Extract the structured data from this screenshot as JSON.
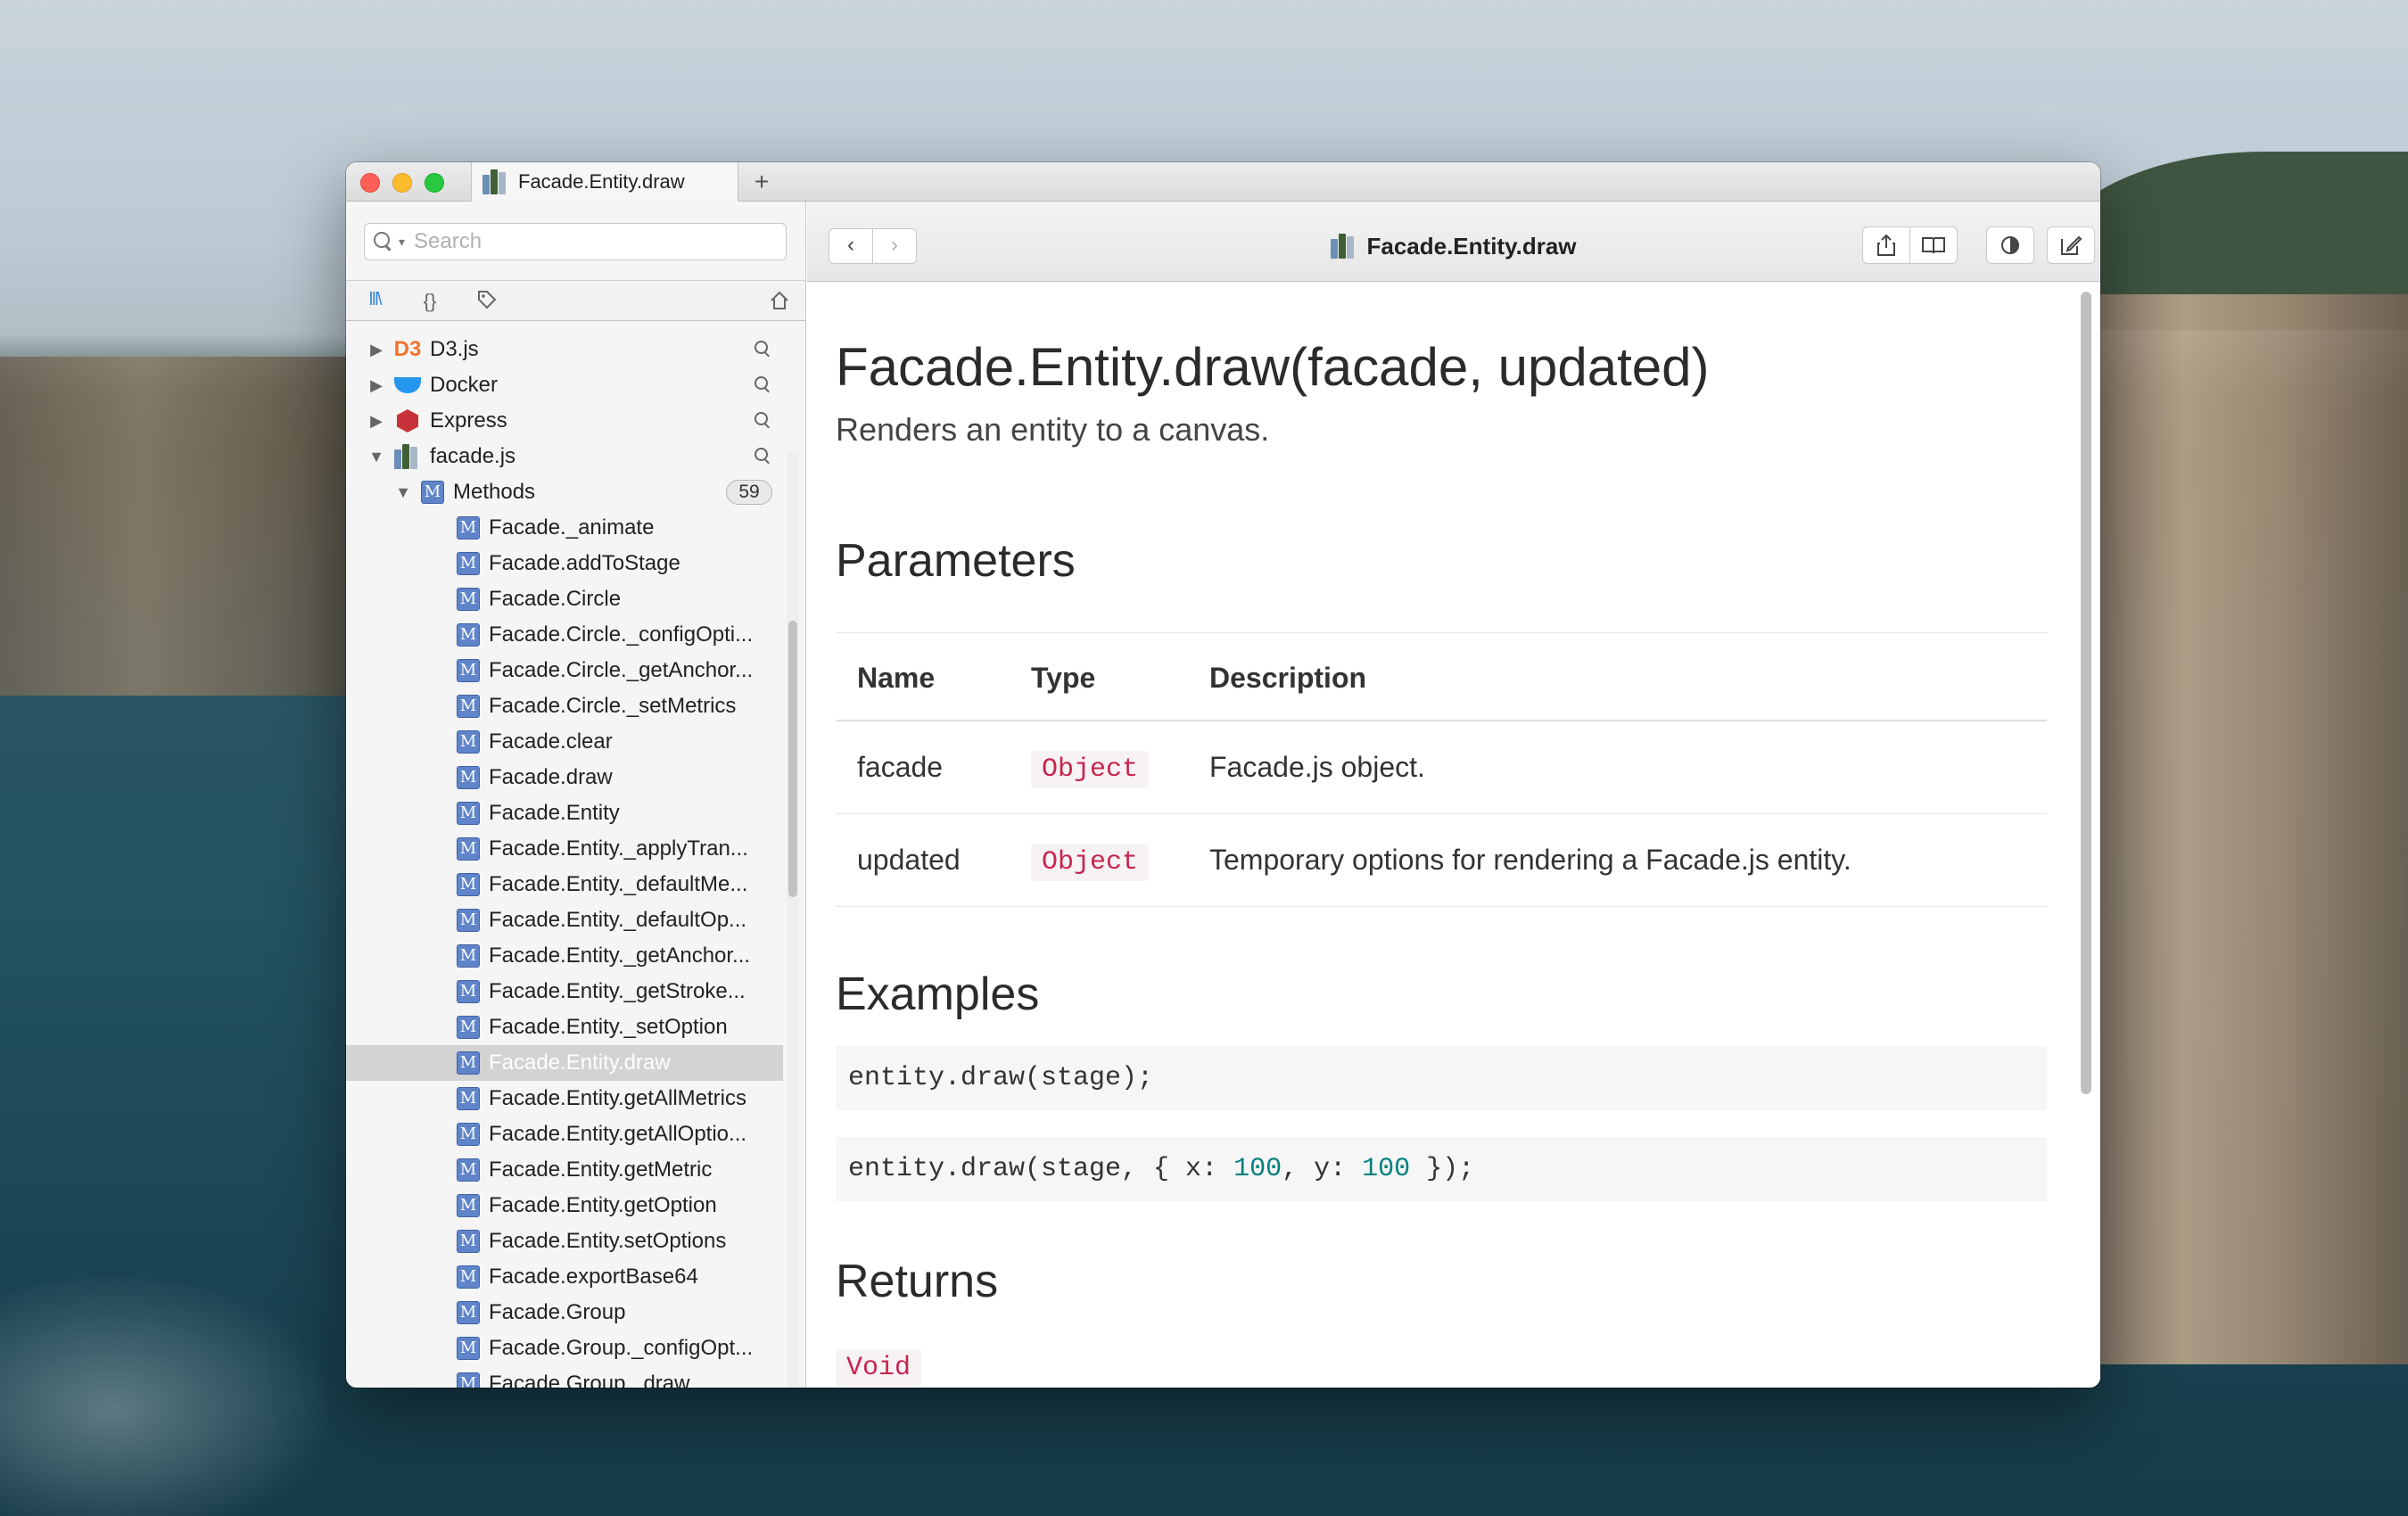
{
  "window": {
    "tab_title": "Facade.Entity.draw",
    "new_tab_label": "+"
  },
  "sidebar": {
    "search_placeholder": "Search",
    "search_value": "",
    "tabs": [
      "docsets-icon",
      "braces-icon",
      "tag-icon",
      "home-icon"
    ],
    "docsets": [
      {
        "label": "D3.js",
        "expanded": false,
        "icon": "d3-icon"
      },
      {
        "label": "Docker",
        "expanded": false,
        "icon": "docker-icon"
      },
      {
        "label": "Express",
        "expanded": false,
        "icon": "express-icon"
      },
      {
        "label": "facade.js",
        "expanded": true,
        "icon": "books-icon"
      }
    ],
    "group": {
      "label": "Methods",
      "count": "59"
    },
    "methods": [
      "Facade._animate",
      "Facade.addToStage",
      "Facade.Circle",
      "Facade.Circle._configOpti...",
      "Facade.Circle._getAnchor...",
      "Facade.Circle._setMetrics",
      "Facade.clear",
      "Facade.draw",
      "Facade.Entity",
      "Facade.Entity._applyTran...",
      "Facade.Entity._defaultMe...",
      "Facade.Entity._defaultOp...",
      "Facade.Entity._getAnchor...",
      "Facade.Entity._getStroke...",
      "Facade.Entity._setOption",
      "Facade.Entity.draw",
      "Facade.Entity.getAllMetrics",
      "Facade.Entity.getAllOptio...",
      "Facade.Entity.getMetric",
      "Facade.Entity.getOption",
      "Facade.Entity.setOptions",
      "Facade.exportBase64",
      "Facade.Group",
      "Facade.Group._configOpt...",
      "Facade.Group._draw"
    ],
    "selected_method": "Facade.Entity.draw"
  },
  "header": {
    "back_label": "‹",
    "forward_label": "›",
    "title": "Facade.Entity.draw",
    "buttons": [
      "share-icon",
      "bookmark-icon",
      "contrast-icon",
      "edit-icon"
    ]
  },
  "content": {
    "heading": "Facade.Entity.draw(facade, updated)",
    "subtitle": "Renders an entity to a canvas.",
    "parameters_heading": "Parameters",
    "table_headers": [
      "Name",
      "Type",
      "Description"
    ],
    "parameters": [
      {
        "name": "facade",
        "type": "Object",
        "description": "Facade.js object."
      },
      {
        "name": "updated",
        "type": "Object",
        "description": "Temporary options for rendering a Facade.js entity."
      }
    ],
    "examples_heading": "Examples",
    "example1": "entity.draw(stage);",
    "example2_prefix": "entity.draw(stage, { x: ",
    "example2_x": "100",
    "example2_mid": ", y: ",
    "example2_y": "100",
    "example2_suffix": " });",
    "returns_heading": "Returns",
    "returns_type": "Void"
  },
  "colors": {
    "accent": "#3b89d8",
    "code_type": "#c7254e",
    "number": "#008080",
    "method_icon": "#5f84c9"
  }
}
